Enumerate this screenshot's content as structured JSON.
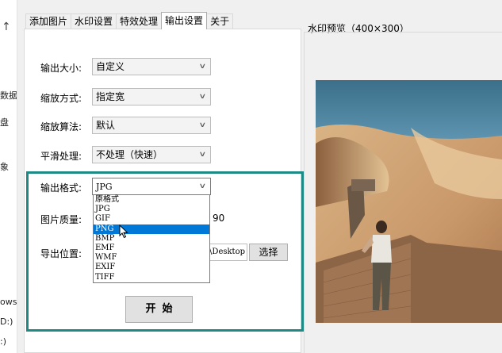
{
  "left_strip": {
    "arrow": "↑",
    "fragments": [
      "数据",
      "盘",
      "象",
      "ows",
      "D:)",
      ":)"
    ]
  },
  "tabs": [
    "添加图片",
    "水印设置",
    "特效处理",
    "输出设置",
    "关于"
  ],
  "active_tab": "输出设置",
  "form": {
    "output_size_label": "输出大小:",
    "output_size_value": "自定义",
    "scale_mode_label": "缩放方式:",
    "scale_mode_value": "指定宽",
    "scale_algo_label": "缩放算法:",
    "scale_algo_value": "默认",
    "smooth_label": "平滑处理:",
    "smooth_value": "不处理（快速）",
    "format_label": "输出格式:",
    "format_value": "JPG",
    "quality_label": "图片质量:",
    "quality_value": "90",
    "export_label": "导出位置:",
    "export_path_visible": "Desktop\\",
    "choose_button": "选择",
    "start_button": "开始"
  },
  "format_dropdown": {
    "options": [
      "原格式",
      "JPG",
      "GIF",
      "PNG",
      "BMP",
      "EMF",
      "WMF",
      "EXIF",
      "TIFF"
    ],
    "highlighted": "PNG"
  },
  "preview": {
    "label": "水印预览（400×300）"
  },
  "colors": {
    "highlight_frame": "#1e8a86",
    "selection": "#0078d7"
  }
}
